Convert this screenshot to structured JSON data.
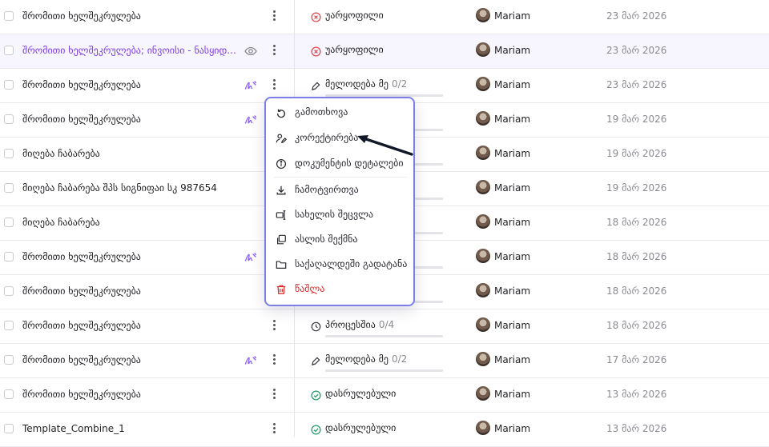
{
  "rows": [
    {
      "name": "შრომითი ხელშეკრულება",
      "status": "უარყოფილი",
      "status_kind": "rejected",
      "count": "",
      "user": "Mariam",
      "date": "23 მარ 2026",
      "hl": false,
      "action": "none"
    },
    {
      "name": "შრომითი ხელშეკრულება; ინვოისი - ნასყიდ...",
      "status": "უარყოფილი",
      "status_kind": "rejected",
      "count": "",
      "user": "Mariam",
      "date": "23 მარ 2026",
      "hl": true,
      "action": "eye"
    },
    {
      "name": "შრომითი ხელშეკრულება",
      "status": "მელოდება მე",
      "status_kind": "waiting",
      "count": "0/2",
      "user": "Mariam",
      "date": "23 მარ 2026",
      "hl": false,
      "action": "sign"
    },
    {
      "name": "შრომითი ხელშეკრულება",
      "status": "",
      "status_kind": "",
      "count": "",
      "user": "Mariam",
      "date": "19 მარ 2026",
      "hl": false,
      "action": "sign"
    },
    {
      "name": "მიღება ჩაბარება",
      "status": "",
      "status_kind": "",
      "count": "",
      "user": "Mariam",
      "date": "19 მარ 2026",
      "hl": false,
      "action": "none"
    },
    {
      "name": "მიღება ჩაბარება შპს სიგნიფაი სკ 987654",
      "status": "",
      "status_kind": "",
      "count": "",
      "user": "Mariam",
      "date": "19 მარ 2026",
      "hl": false,
      "action": "none"
    },
    {
      "name": "მიღება ჩაბარება",
      "status": "",
      "status_kind": "",
      "count": "",
      "user": "Mariam",
      "date": "18 მარ 2026",
      "hl": false,
      "action": "none"
    },
    {
      "name": "შრომითი ხელშეკრულება",
      "status": "",
      "status_kind": "",
      "count": "",
      "user": "Mariam",
      "date": "18 მარ 2026",
      "hl": false,
      "action": "sign"
    },
    {
      "name": "შრომითი ხელშეკრულება",
      "status": "",
      "status_kind": "",
      "count": "",
      "user": "Mariam",
      "date": "18 მარ 2026",
      "hl": false,
      "action": "none"
    },
    {
      "name": "შრომითი ხელშეკრულება",
      "status": "პროცესშია",
      "status_kind": "progress",
      "count": "0/4",
      "user": "Mariam",
      "date": "18 მარ 2026",
      "hl": false,
      "action": "none"
    },
    {
      "name": "შრომითი ხელშეკრულება",
      "status": "მელოდება მე",
      "status_kind": "waiting",
      "count": "0/2",
      "user": "Mariam",
      "date": "17 მარ 2026",
      "hl": false,
      "action": "sign"
    },
    {
      "name": "შრომითი ხელშეკრულება",
      "status": "დასრულებული",
      "status_kind": "done",
      "count": "",
      "user": "Mariam",
      "date": "13 მარ 2026",
      "hl": false,
      "action": "none"
    },
    {
      "name": "Template_Combine_1",
      "status": "დასრულებული",
      "status_kind": "done",
      "count": "",
      "user": "Mariam",
      "date": "13 მარ 2026",
      "hl": false,
      "action": "none"
    }
  ],
  "menu": {
    "items": [
      {
        "label": "გამოთხოვა",
        "icon": "undo-icon"
      },
      {
        "label": "კორექტირება",
        "icon": "edit-person-icon"
      },
      {
        "label": "დოკუმენტის დეტალები",
        "icon": "info-icon"
      },
      {
        "label": "ჩამოტვირთვა",
        "icon": "download-icon"
      },
      {
        "label": "სახელის შეცვლა",
        "icon": "rename-icon"
      },
      {
        "label": "ასლის შექმნა",
        "icon": "copy-icon"
      },
      {
        "label": "საქაღალდეში გადატანა",
        "icon": "folder-icon"
      },
      {
        "label": "წაშლა",
        "icon": "trash-icon"
      }
    ]
  },
  "colors": {
    "accent": "#7b3fe4",
    "rejected": "#e5484d",
    "done": "#22a06b",
    "danger": "#dc2626",
    "menu_border": "#7b7fe6"
  }
}
